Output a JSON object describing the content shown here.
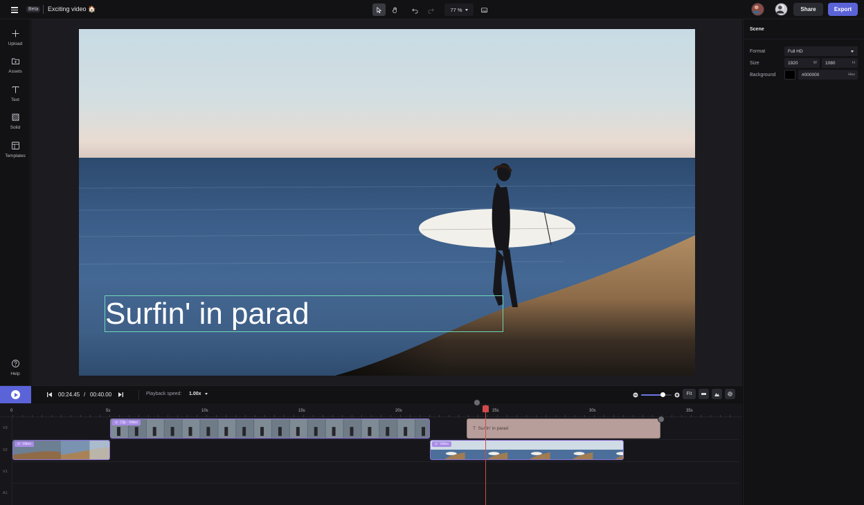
{
  "topbar": {
    "badge": "Beta",
    "project_title": "Exciting video 🏠",
    "zoom": "77 %",
    "share_label": "Share",
    "export_label": "Export"
  },
  "sidebar": {
    "items": [
      {
        "label": "Upload",
        "icon": "plus-icon"
      },
      {
        "label": "Assets",
        "icon": "folder-icon"
      },
      {
        "label": "Text",
        "icon": "text-icon"
      },
      {
        "label": "Solid",
        "icon": "solid-icon"
      },
      {
        "label": "Templates",
        "icon": "templates-icon"
      }
    ],
    "help_label": "Help"
  },
  "canvas": {
    "caption": "Surfin' in parad"
  },
  "panel": {
    "title": "Scene",
    "format_label": "Format",
    "format_value": "Full HD",
    "size_label": "Size",
    "width_value": "1920",
    "width_suffix": "W",
    "height_value": "1080",
    "height_suffix": "H",
    "background_label": "Background",
    "background_value": "#000000",
    "background_suffix": "Hex"
  },
  "transport": {
    "current_time": "00:24.45",
    "time_sep": "/",
    "total_time": "00:40.00",
    "speed_label": "Playback speed:",
    "speed_value": "1.00x",
    "fit_label": "Fit",
    "zoom_level": 0.72
  },
  "timeline": {
    "ruler": [
      "0",
      "5s",
      "10s",
      "15s",
      "20s",
      "25s",
      "30s",
      "35s"
    ],
    "tracks": [
      "V3",
      "V2",
      "V1",
      "A1"
    ],
    "clips": {
      "v3_video": "Clip · Video",
      "v3_text": "Surfin' in parad",
      "v2_video_a": "Video",
      "v2_video_b": "Video"
    },
    "playhead_time": "00:24.45"
  },
  "colors": {
    "accent": "#5b63d9",
    "clip_video": "#a88be6",
    "clip_text": "#b89e9b",
    "playhead": "#d04a4a",
    "caption_outline": "#6fd8b8"
  }
}
